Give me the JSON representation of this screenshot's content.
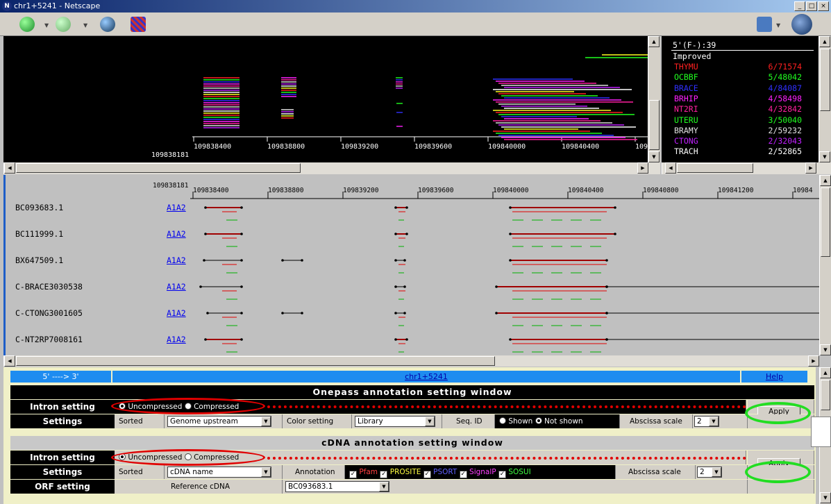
{
  "window": {
    "title": "chr1+5241 - Netscape",
    "logo": "N",
    "min": "_",
    "max": "□",
    "close": "×"
  },
  "toolbar": {
    "icons": [
      "back-icon",
      "forward-icon",
      "reload-icon",
      "security-icon",
      "print-icon",
      "netscape-icon"
    ]
  },
  "overview": {
    "start_label": "109838181",
    "ticks": [
      "109838400",
      "109838800",
      "109839200",
      "109839600",
      "109840000",
      "109840400",
      "109"
    ]
  },
  "legend": {
    "header": "5'(F-):39",
    "subheader": "Improved",
    "rows": [
      {
        "name": "THYMU",
        "value": "6/71574",
        "color": "#ff2020"
      },
      {
        "name": "OCBBF",
        "value": "5/48042",
        "color": "#20ff20"
      },
      {
        "name": "BRACE",
        "value": "4/84087",
        "color": "#3030ff"
      },
      {
        "name": "BRHIP",
        "value": "4/58498",
        "color": "#ff20ff"
      },
      {
        "name": "NT2RI",
        "value": "4/32842",
        "color": "#ff20a0"
      },
      {
        "name": "UTERU",
        "value": "3/50040",
        "color": "#20ff20"
      },
      {
        "name": "BRAMY",
        "value": "2/59232",
        "color": "#e0e0e0"
      },
      {
        "name": "CTONG",
        "value": "2/32043",
        "color": "#c020ff"
      },
      {
        "name": "TRACH",
        "value": "2/52865",
        "color": "#ffffff"
      }
    ]
  },
  "detail": {
    "start_label": "109838181",
    "ticks": [
      "109838400",
      "109838800",
      "109839200",
      "109839600",
      "109840000",
      "109840400",
      "109840800",
      "109841200",
      "10984"
    ],
    "rows": [
      {
        "name": "BC093683.1",
        "link": "A1A2"
      },
      {
        "name": "BC111999.1",
        "link": "A1A2"
      },
      {
        "name": "BX647509.1",
        "link": "A1A2"
      },
      {
        "name": "C-BRACE3030538",
        "link": "A1A2"
      },
      {
        "name": "C-CTONG3001605",
        "link": "A1A2"
      },
      {
        "name": "C-NT2RP7008161",
        "link": "A1A2"
      }
    ]
  },
  "panel": {
    "direction": "5' ----> 3'",
    "chr_link": "chr1+5241",
    "help": "Help",
    "onepass": {
      "title": "Onepass annotation setting window",
      "intron_label": "Intron setting",
      "uncompressed": "Uncompressed",
      "compressed": "Compressed",
      "settings_label": "Settings",
      "sorted": "Sorted",
      "sorted_value": "Genome upstream",
      "color_setting": "Color setting",
      "color_value": "Library",
      "seq_id": "Seq. ID",
      "shown": "Shown",
      "not_shown": "Not shown",
      "abscissa": "Abscissa scale",
      "abscissa_value": "2",
      "apply": "Apply"
    },
    "cdna": {
      "title": "cDNA annotation setting window",
      "intron_label": "Intron setting",
      "uncompressed": "Uncompressed",
      "compressed": "Compressed",
      "settings_label": "Settings",
      "sorted": "Sorted",
      "sorted_value": "cDNA name",
      "annotation": "Annotation",
      "pfam": "Pfam",
      "prosite": "PROSITE",
      "psort": "PSORT",
      "signalp": "SignalP",
      "sosui": "SOSUI",
      "abscissa": "Abscissa scale",
      "abscissa_value": "2",
      "apply": "Apply",
      "orf_label": "ORF setting",
      "reference": "Reference cDNA",
      "reference_value": "BC093683.1"
    }
  }
}
